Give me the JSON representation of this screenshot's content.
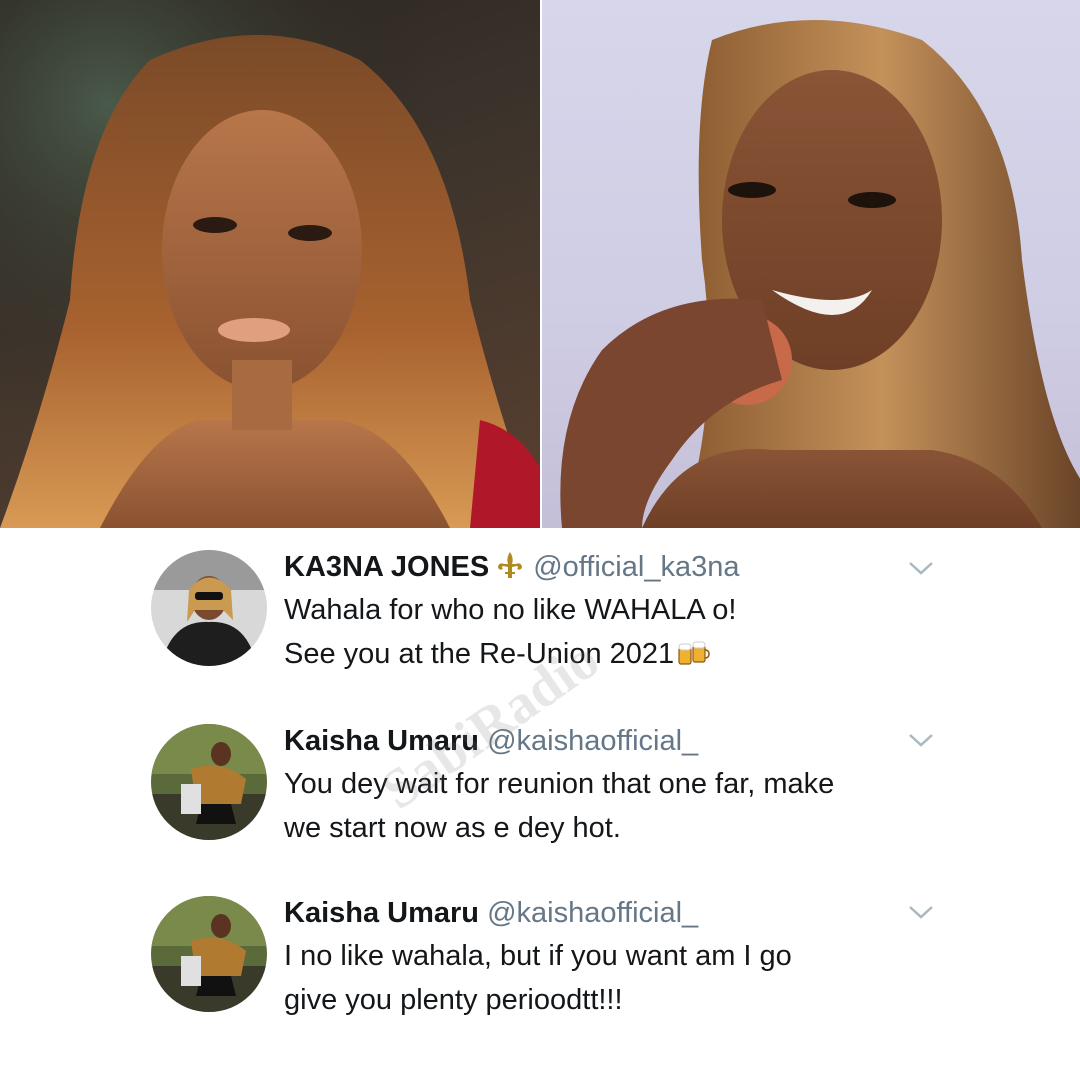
{
  "photos": {
    "left_alt": "Portrait of a woman with long auburn hair",
    "right_alt": "Portrait of a smiling woman holding an apple"
  },
  "tweets": [
    {
      "name": "KA3NA JONES",
      "verified_icon": "fleur-de-lis-icon",
      "handle": "@official_ka3na",
      "lines": [
        "Wahala for who no like WAHALA o!",
        "See you at the Re-Union 2021"
      ],
      "emoji": "beer-mugs-icon"
    },
    {
      "name": "Kaisha Umaru",
      "handle": "@kaishaofficial_",
      "lines": [
        "You dey wait for reunion that one far, make",
        "we start now as e dey hot."
      ]
    },
    {
      "name": "Kaisha Umaru",
      "handle": "@kaishaofficial_",
      "lines": [
        "I no like wahala, but if you want am I go",
        "give you plenty perioodtt!!!"
      ]
    }
  ],
  "watermark": "SabiRadio",
  "colors": {
    "name": "#14171a",
    "handle": "#657786",
    "chevron": "#aab8c2"
  }
}
